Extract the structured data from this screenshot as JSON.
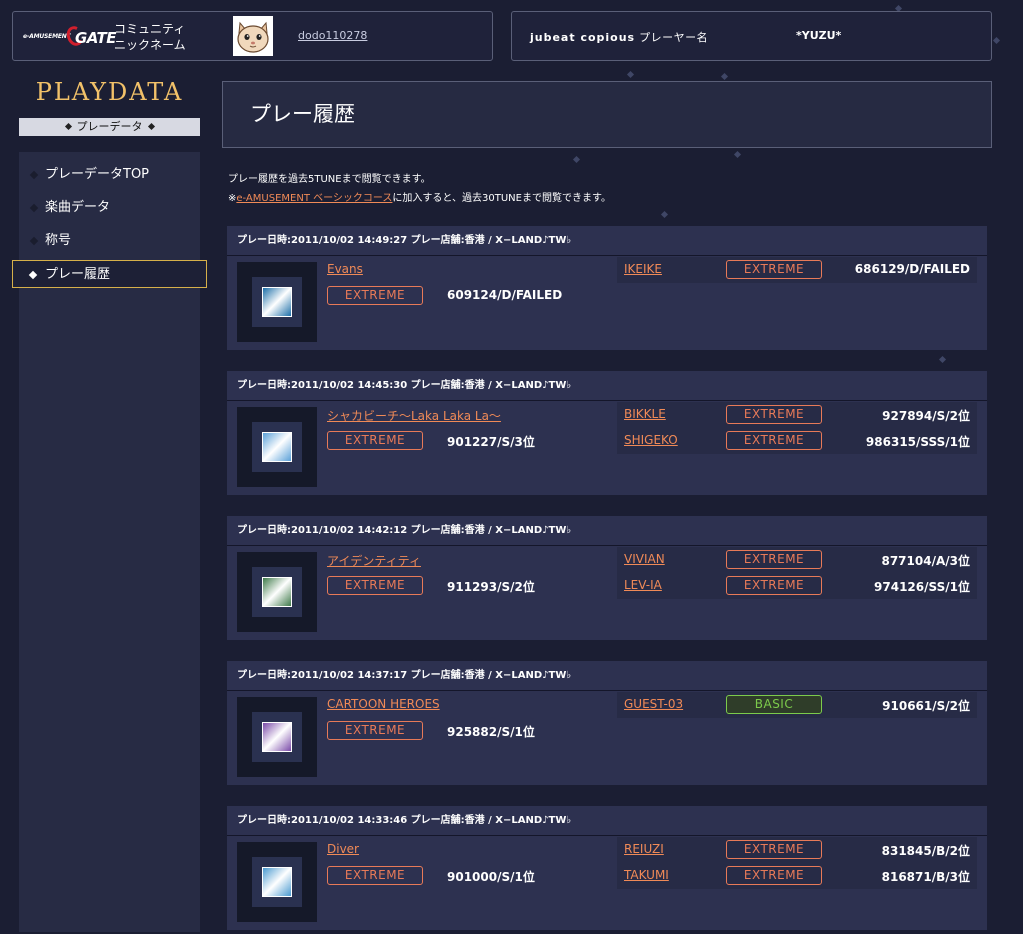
{
  "header": {
    "logo_prefix": "e-AMUSEMENT",
    "logo_text": "GATE",
    "community_line1": "コミュニティ",
    "community_line2": "ニックネーム",
    "nickname": "dodo110278",
    "jubeat_label": "jubeat copious",
    "player_name_label": "プレーヤー名",
    "player_name": "*YUZU*"
  },
  "sidebar": {
    "title": "PLAYDATA",
    "subtitle": "プレーデータ",
    "items": [
      {
        "label": "プレーデータTOP"
      },
      {
        "label": "楽曲データ"
      },
      {
        "label": "称号"
      },
      {
        "label": "プレー履歴",
        "active": true
      }
    ]
  },
  "main": {
    "page_title": "プレー履歴",
    "note1": "プレー履歴を過去5TUNEまで閲覧できます。",
    "note2_mark": "※",
    "note2_link": "e-AMUSEMENT ベーシックコース",
    "note2_rest": "に加入すると、過去30TUNEまで閲覧できます。",
    "sessions": [
      {
        "header": "プレー日時:2011/10/02 14:49:27  プレー店舗:香港 / X−LAND♪TW♭",
        "song": "Evans",
        "difficulty": "EXTREME",
        "score": "609124/D/FAILED",
        "jacket_color": "#1d6fa8",
        "rivals": [
          {
            "name": "IKEIKE",
            "difficulty": "EXTREME",
            "score": "686129/D/FAILED"
          }
        ]
      },
      {
        "header": "プレー日時:2011/10/02 14:45:30  プレー店舗:香港 / X−LAND♪TW♭",
        "song": "シャカビーチ〜Laka Laka La〜",
        "difficulty": "EXTREME",
        "score": "901227/S/3位",
        "jacket_color": "#5aa0d8",
        "rivals": [
          {
            "name": "BIKKLE",
            "difficulty": "EXTREME",
            "score": "927894/S/2位"
          },
          {
            "name": "SHIGEKO",
            "difficulty": "EXTREME",
            "score": "986315/SSS/1位"
          }
        ]
      },
      {
        "header": "プレー日時:2011/10/02 14:42:12  プレー店舗:香港 / X−LAND♪TW♭",
        "song": "アイデンティティ",
        "difficulty": "EXTREME",
        "score": "911293/S/2位",
        "jacket_color": "#3f7a4a",
        "rivals": [
          {
            "name": "VIVIAN",
            "difficulty": "EXTREME",
            "score": "877104/A/3位"
          },
          {
            "name": "LEV-IA",
            "difficulty": "EXTREME",
            "score": "974126/SS/1位"
          }
        ]
      },
      {
        "header": "プレー日時:2011/10/02 14:37:17  プレー店舗:香港 / X−LAND♪TW♭",
        "song": "CARTOON HEROES",
        "difficulty": "EXTREME",
        "score": "925882/S/1位",
        "jacket_color": "#7a4aa8",
        "rivals": [
          {
            "name": "GUEST-03",
            "difficulty": "BASIC",
            "score": "910661/S/2位"
          }
        ]
      },
      {
        "header": "プレー日時:2011/10/02 14:33:46  プレー店舗:香港 / X−LAND♪TW♭",
        "song": "Diver",
        "difficulty": "EXTREME",
        "score": "901000/S/1位",
        "jacket_color": "#4a9ad0",
        "rivals": [
          {
            "name": "REIUZI",
            "difficulty": "EXTREME",
            "score": "831845/B/2位"
          },
          {
            "name": "TAKUMI",
            "difficulty": "EXTREME",
            "score": "816871/B/3位"
          }
        ]
      }
    ]
  }
}
